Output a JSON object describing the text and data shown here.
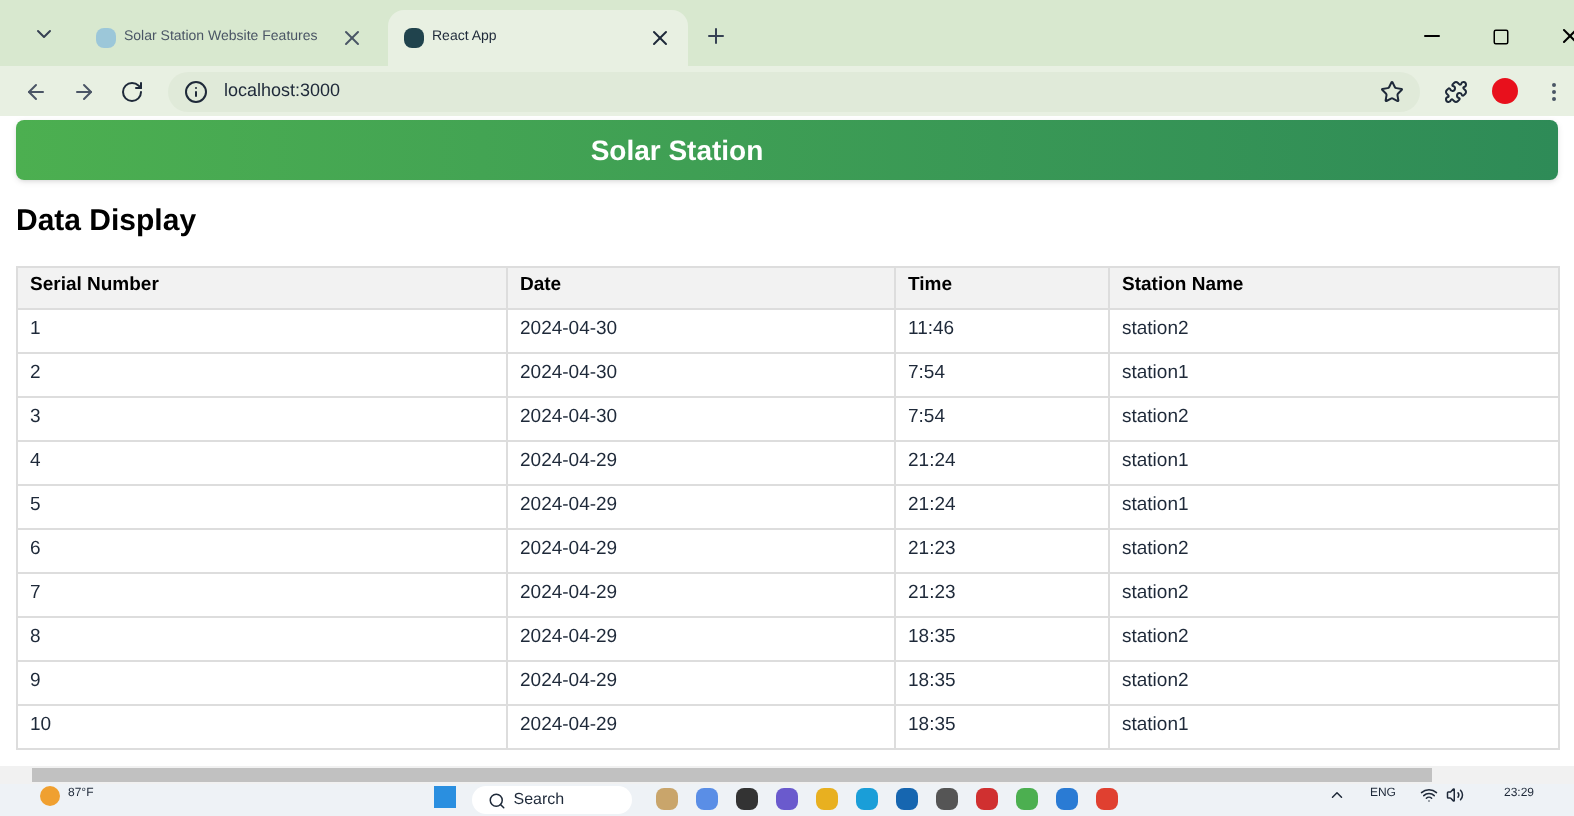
{
  "browser": {
    "tabs": [
      {
        "title": "Solar Station Website Features",
        "selected": false
      },
      {
        "title": "React App",
        "selected": true
      }
    ],
    "address": "localhost:3000"
  },
  "header": {
    "title": "Solar Station"
  },
  "section_title": "Data Display",
  "table": {
    "columns": [
      "Serial Number",
      "Date",
      "Time",
      "Station Name"
    ],
    "rows": [
      [
        "1",
        "2024-04-30",
        "11:46",
        "station2"
      ],
      [
        "2",
        "2024-04-30",
        "7:54",
        "station1"
      ],
      [
        "3",
        "2024-04-30",
        "7:54",
        "station2"
      ],
      [
        "4",
        "2024-04-29",
        "21:24",
        "station1"
      ],
      [
        "5",
        "2024-04-29",
        "21:24",
        "station1"
      ],
      [
        "6",
        "2024-04-29",
        "21:23",
        "station2"
      ],
      [
        "7",
        "2024-04-29",
        "21:23",
        "station2"
      ],
      [
        "8",
        "2024-04-29",
        "18:35",
        "station2"
      ],
      [
        "9",
        "2024-04-29",
        "18:35",
        "station2"
      ],
      [
        "10",
        "2024-04-29",
        "18:35",
        "station1"
      ]
    ]
  },
  "taskbar": {
    "weather": "87°F",
    "search": "Search",
    "language": "ENG",
    "time": "23:29"
  }
}
